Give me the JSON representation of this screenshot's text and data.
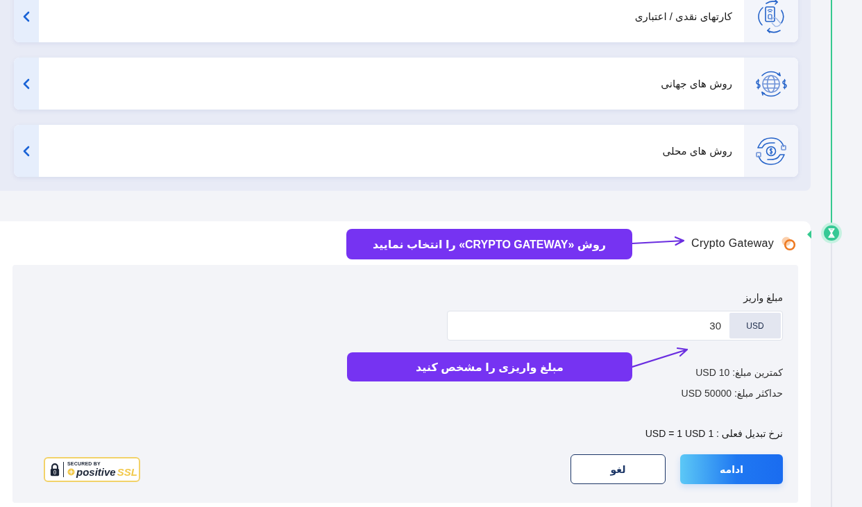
{
  "payment_methods": [
    {
      "kind": "cards",
      "title": "کارتهای نقدی / اعتباری"
    },
    {
      "kind": "global",
      "title": "روش های جهانی"
    },
    {
      "kind": "local",
      "title": "روش های محلی"
    }
  ],
  "gateway": {
    "title": "Crypto Gateway"
  },
  "form": {
    "amount_label": "مبلغ واریز",
    "amount": {
      "value": "30",
      "currency": "USD"
    },
    "limits": [
      "کمترین مبلغ: 10 USD",
      "حداکثر مبلغ: 50000 USD"
    ],
    "rate": "نرخ تبدیل فعلی : 1 USD = 1 USD",
    "buttons": [
      {
        "kind": "primary",
        "label": "ادامه"
      },
      {
        "kind": "secondary",
        "label": "لغو"
      }
    ]
  },
  "ssl_badge": {
    "caption": "SECURED BY",
    "brand": "positive",
    "brand_suffix": "SSL"
  },
  "annotations": [
    {
      "text": "روش «CRYPTO GATEWAY» را انتخاب نمایید"
    },
    {
      "text": "مبلغ واریزی را مشخص کنید"
    }
  ]
}
